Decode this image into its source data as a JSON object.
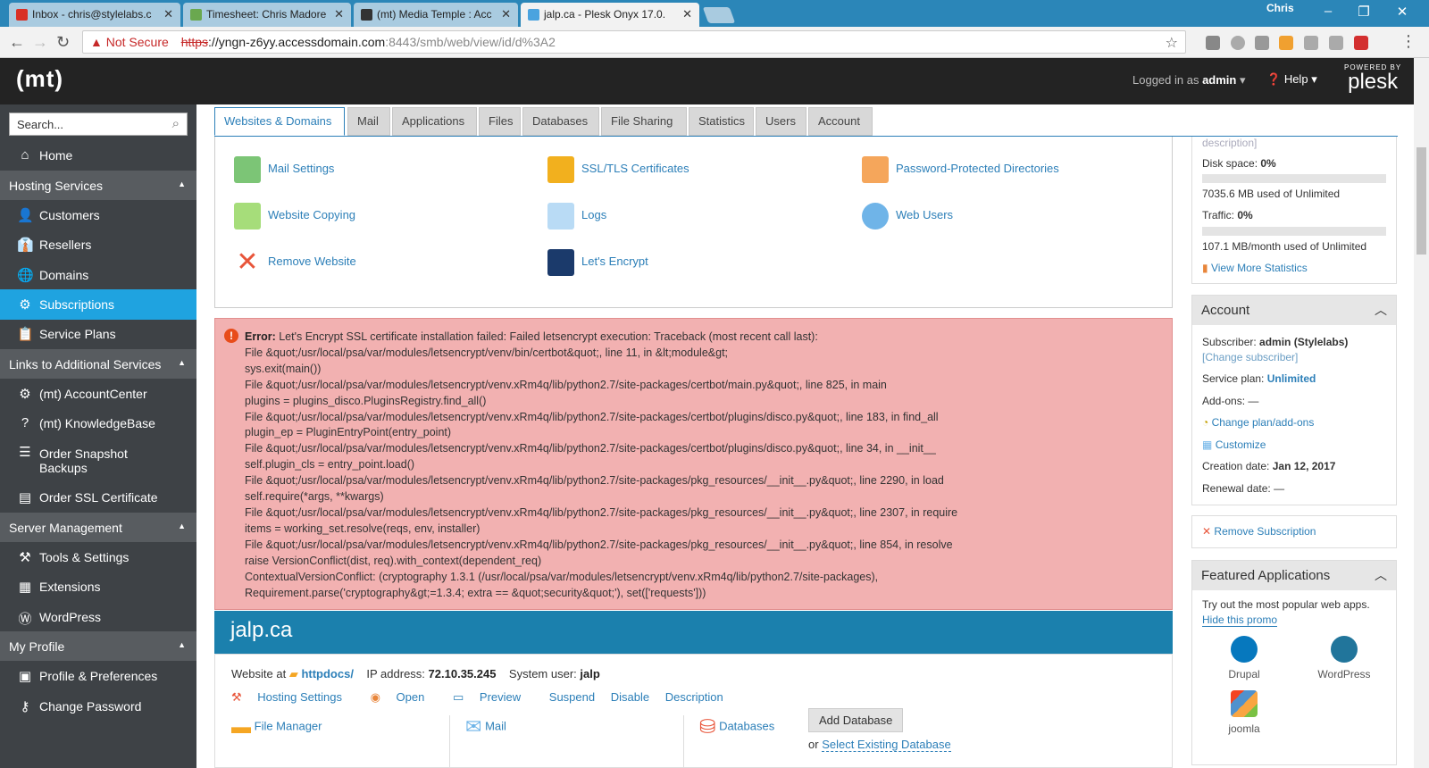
{
  "browser": {
    "tabs": [
      {
        "title": "Inbox - chris@stylelabs.c",
        "active": false
      },
      {
        "title": "Timesheet: Chris Madore",
        "active": false
      },
      {
        "title": "(mt) Media Temple : Acc",
        "active": false
      },
      {
        "title": "jalp.ca - Plesk Onyx 17.0.",
        "active": true
      }
    ],
    "profile_name": "Chris",
    "security_label": "Not Secure",
    "url_scheme": "https",
    "url_host": "://yngn-z6yy.accessdomain.com",
    "url_path": ":8443/smb/web/view/id/d%3A2"
  },
  "header": {
    "logo": "(mt)",
    "logged_in_prefix": "Logged in as",
    "user": "admin",
    "help_label": "Help",
    "powered_by": "POWERED BY",
    "plesk": "plesk"
  },
  "sidebar": {
    "search_placeholder": "Search...",
    "home": "Home",
    "groups": [
      {
        "label": "Hosting Services"
      },
      {
        "label": "Links to Additional Services"
      },
      {
        "label": "Server Management"
      },
      {
        "label": "My Profile"
      }
    ],
    "items": {
      "customers": "Customers",
      "resellers": "Resellers",
      "domains": "Domains",
      "subscriptions": "Subscriptions",
      "service_plans": "Service Plans",
      "account_center": "(mt) AccountCenter",
      "knowledge_base": "(mt) KnowledgeBase",
      "order_snapshot": "Order Snapshot Backups",
      "order_ssl": "Order SSL Certificate",
      "tools_settings": "Tools & Settings",
      "extensions": "Extensions",
      "wordpress": "WordPress",
      "profile_prefs": "Profile & Preferences",
      "change_password": "Change Password"
    }
  },
  "content_tabs": [
    "Websites & Domains",
    "Mail",
    "Applications",
    "Files",
    "Databases",
    "File Sharing",
    "Statistics",
    "Users",
    "Account"
  ],
  "tools": {
    "mail_settings": "Mail Settings",
    "ssl_certs": "SSL/TLS Certificates",
    "password_dirs": "Password-Protected Directories",
    "website_copying": "Website Copying",
    "logs": "Logs",
    "web_users": "Web Users",
    "remove_website": "Remove Website",
    "lets_encrypt": "Let's Encrypt"
  },
  "error": {
    "label": "Error:",
    "lines": [
      "Let's Encrypt SSL certificate installation failed: Failed letsencrypt execution: Traceback (most recent call last):",
      "File &quot;/usr/local/psa/var/modules/letsencrypt/venv/bin/certbot&quot;, line 11, in &lt;module&gt;",
      "sys.exit(main())",
      "File &quot;/usr/local/psa/var/modules/letsencrypt/venv.xRm4q/lib/python2.7/site-packages/certbot/main.py&quot;, line 825, in main",
      "plugins = plugins_disco.PluginsRegistry.find_all()",
      "File &quot;/usr/local/psa/var/modules/letsencrypt/venv.xRm4q/lib/python2.7/site-packages/certbot/plugins/disco.py&quot;, line 183, in find_all",
      "plugin_ep = PluginEntryPoint(entry_point)",
      "File &quot;/usr/local/psa/var/modules/letsencrypt/venv.xRm4q/lib/python2.7/site-packages/certbot/plugins/disco.py&quot;, line 34, in __init__",
      "self.plugin_cls = entry_point.load()",
      "File &quot;/usr/local/psa/var/modules/letsencrypt/venv.xRm4q/lib/python2.7/site-packages/pkg_resources/__init__.py&quot;, line 2290, in load",
      "self.require(*args, **kwargs)",
      "File &quot;/usr/local/psa/var/modules/letsencrypt/venv.xRm4q/lib/python2.7/site-packages/pkg_resources/__init__.py&quot;, line 2307, in require",
      "items = working_set.resolve(reqs, env, installer)",
      "File &quot;/usr/local/psa/var/modules/letsencrypt/venv.xRm4q/lib/python2.7/site-packages/pkg_resources/__init__.py&quot;, line 854, in resolve",
      "raise VersionConflict(dist, req).with_context(dependent_req)",
      "ContextualVersionConflict: (cryptography 1.3.1 (/usr/local/psa/var/modules/letsencrypt/venv.xRm4q/lib/python2.7/site-packages),",
      "Requirement.parse('cryptography&gt;=1.3.4; extra == &quot;security&quot;'), set(['requests']))"
    ]
  },
  "domain": {
    "name": "jalp.ca",
    "website_at_label": "Website at",
    "docroot": "httpdocs/",
    "ip_label": "IP address:",
    "ip": "72.10.35.245",
    "sysuser_label": "System user:",
    "sysuser": "jalp",
    "links": [
      "Hosting Settings",
      "Open",
      "Preview",
      "Suspend",
      "Disable",
      "Description"
    ],
    "file_manager": "File Manager",
    "mail": "Mail",
    "databases": "Databases",
    "add_database": "Add Database",
    "or": "or",
    "select_existing": "Select Existing Database"
  },
  "stats": {
    "desc_fragment": "description]",
    "disk_label": "Disk space:",
    "disk_pct": "0%",
    "disk_used_fraction": 0,
    "disk_used": "7035.6 MB used of Unlimited",
    "traffic_label": "Traffic:",
    "traffic_pct": "0%",
    "traffic_used_fraction": 0,
    "traffic_used": "107.1 MB/month used of Unlimited",
    "more_stats": "View More Statistics"
  },
  "account": {
    "title": "Account",
    "subscriber_label": "Subscriber:",
    "subscriber": "admin (Stylelabs)",
    "change_subscriber": "[Change subscriber]",
    "plan_label": "Service plan:",
    "plan": "Unlimited",
    "addons_label": "Add-ons:",
    "addons": "—",
    "change_plan": "Change plan/add-ons",
    "customize": "Customize",
    "creation_label": "Creation date:",
    "creation": "Jan 12, 2017",
    "renewal_label": "Renewal date:",
    "renewal": "—"
  },
  "remove_subscription": "Remove Subscription",
  "featured": {
    "title": "Featured Applications",
    "promo": "Try out the most popular web apps.",
    "hide": "Hide this promo",
    "apps": [
      "Drupal",
      "WordPress",
      "joomla"
    ]
  },
  "colors": {
    "accent": "#1fa3e0",
    "link": "#2c7fb8",
    "error_bg": "#f2b1b1",
    "domain_bar": "#1b80ad",
    "sidebar": "#3e4246"
  }
}
